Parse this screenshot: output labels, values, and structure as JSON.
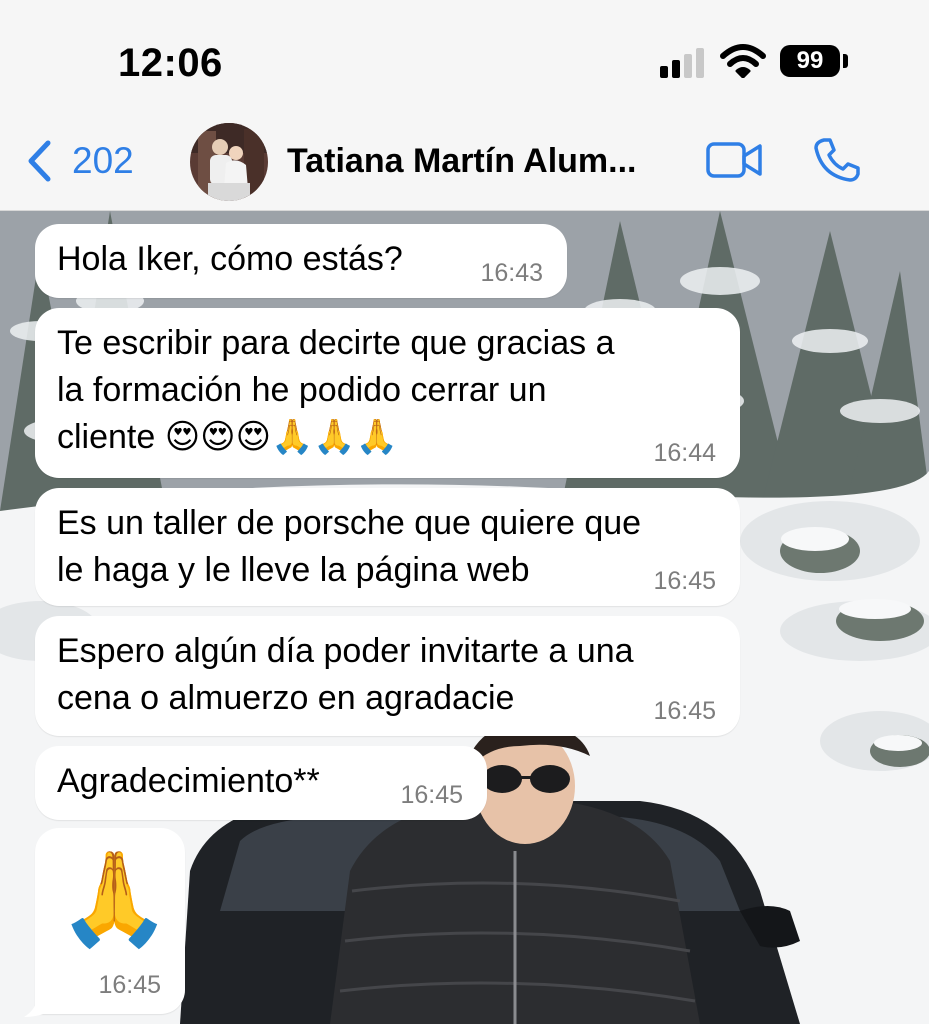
{
  "status_bar": {
    "time": "12:06",
    "battery": "99"
  },
  "header": {
    "back_count": "202",
    "contact_name": "Tatiana Martín Alum..."
  },
  "messages": [
    {
      "lines": [
        "Hola Iker, cómo estás?"
      ],
      "time": "16:43"
    },
    {
      "lines": [
        "Te escribir para decirte que gracias a",
        "la formación he podido cerrar un",
        "cliente 😍😍😍🙏🙏🙏"
      ],
      "time": "16:44"
    },
    {
      "lines": [
        "Es un taller de porsche que quiere que",
        "le haga y le lleve la página web"
      ],
      "time": "16:45"
    },
    {
      "lines": [
        "Espero algún día poder invitarte a una",
        "cena o almuerzo en agradacie"
      ],
      "time": "16:45"
    },
    {
      "lines": [
        "Agradecimiento**"
      ],
      "time": "16:45"
    },
    {
      "emoji": "🙏",
      "time": "16:45"
    }
  ],
  "colors": {
    "accent": "#2f7fe6",
    "bubble": "#ffffff",
    "timestamp": "#7d7d7d"
  },
  "icons": [
    "chevron-left-icon",
    "video-camera-icon",
    "phone-icon",
    "wifi-icon",
    "signal-icon",
    "battery-icon"
  ]
}
